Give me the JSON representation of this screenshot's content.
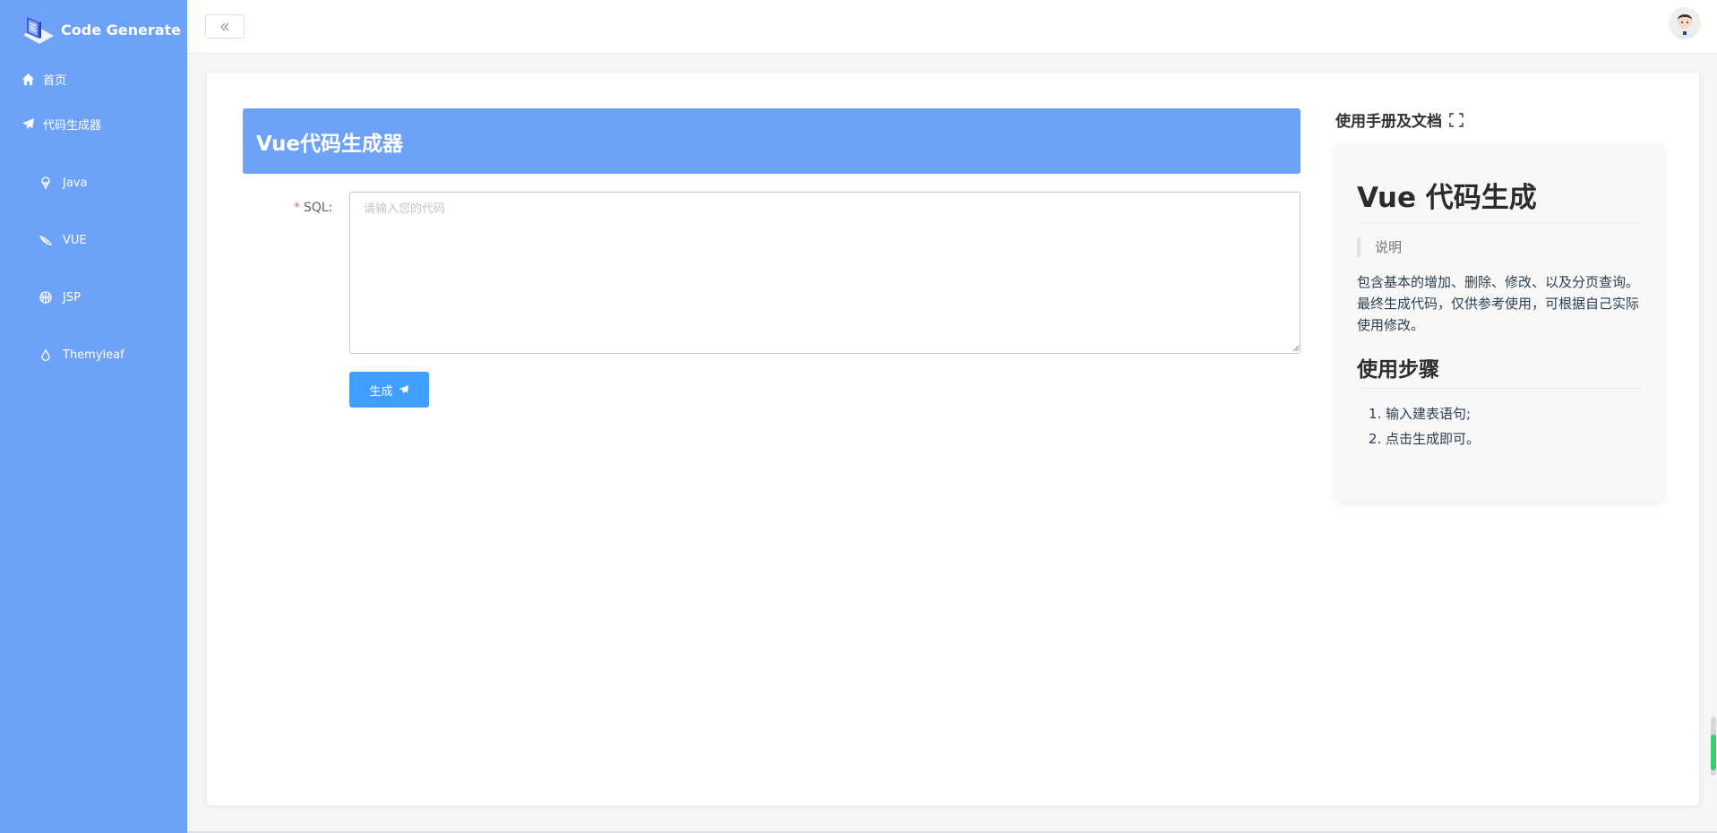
{
  "brand": {
    "title": "Code Generate"
  },
  "sidebar": {
    "items": [
      {
        "label": "首页",
        "icon": "home-icon"
      },
      {
        "label": "代码生成器",
        "icon": "paper-plane-icon"
      }
    ],
    "sub_items": [
      {
        "label": "Java",
        "icon": "coffee-icon"
      },
      {
        "label": "VUE",
        "icon": "vue-icon"
      },
      {
        "label": "JSP",
        "icon": "basketball-icon"
      },
      {
        "label": "Themyleaf",
        "icon": "leaf-drop-icon"
      }
    ]
  },
  "header": {
    "collapse_icon": "double-chevron-left-icon"
  },
  "main": {
    "banner_title": "Vue代码生成器",
    "form": {
      "required_mark": "*",
      "sql_label": "SQL:",
      "sql_placeholder": "请输入您的代码",
      "sql_value": ""
    },
    "generate_button": "生成"
  },
  "docs": {
    "heading": "使用手册及文档",
    "h1": "Vue 代码生成",
    "quote": "说明",
    "para1": "包含基本的增加、删除、修改、以及分页查询。",
    "para2": "最终生成代码，仅供参考使用，可根据自己实际使用修改。",
    "h2": "使用步骤",
    "steps": [
      "输入建表语句;",
      "点击生成即可。"
    ]
  },
  "colors": {
    "sidebar_bg": "#6ea2f8",
    "primary_button": "#409eff",
    "required": "#f56c6c"
  }
}
